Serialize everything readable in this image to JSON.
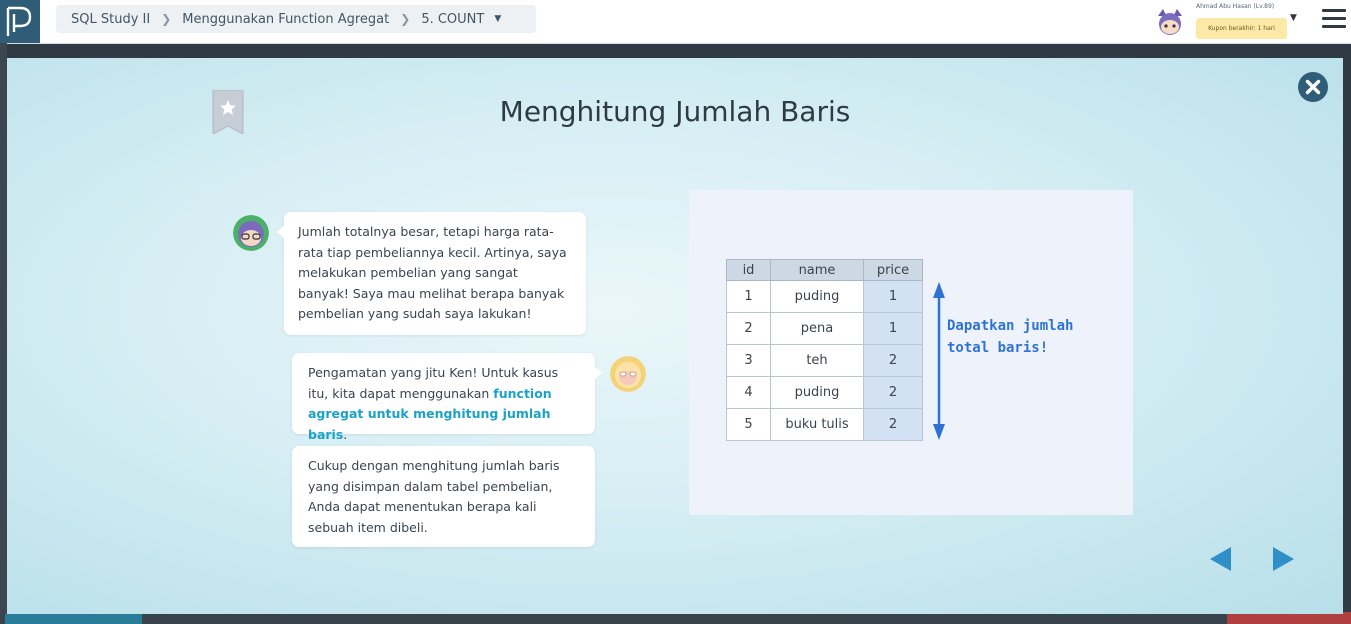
{
  "breadcrumb": {
    "course": "SQL Study II",
    "chapter": "Menggunakan Function Agregat",
    "lesson": "5. COUNT"
  },
  "user": {
    "name": "Ahmad Abu Hasan (Lv.89)",
    "coupon": "Kupon berakhir: 1 hari"
  },
  "slide": {
    "title": "Menghitung Jumlah Baris",
    "messages": [
      "Jumlah totalnya besar, tetapi harga rata-rata tiap pembeliannya kecil. Artinya, saya melakukan pembelian yang sangat banyak! Saya mau melihat berapa banyak pembelian yang sudah saya lakukan!",
      "Cukup dengan menghitung jumlah baris yang disimpan dalam tabel pembelian, Anda dapat menentukan berapa kali sebuah item dibeli."
    ],
    "message2": {
      "prefix": "Pengamatan yang jitu Ken! Untuk kasus itu, kita dapat menggunakan ",
      "highlight": "function agregat untuk menghitung jumlah baris",
      "suffix": "."
    }
  },
  "illustration": {
    "headers": [
      "id",
      "name",
      "price"
    ],
    "rows": [
      [
        "1",
        "puding",
        "1"
      ],
      [
        "2",
        "pena",
        "1"
      ],
      [
        "3",
        "teh",
        "2"
      ],
      [
        "4",
        "puding",
        "2"
      ],
      [
        "5",
        "buku tulis",
        "2"
      ]
    ],
    "arrow_label_line1": "Dapatkan jumlah",
    "arrow_label_line2": "total baris!"
  },
  "colors": {
    "highlight": "#1ba2c8",
    "arrow": "#2f72d6",
    "close": "#2f5d77"
  }
}
